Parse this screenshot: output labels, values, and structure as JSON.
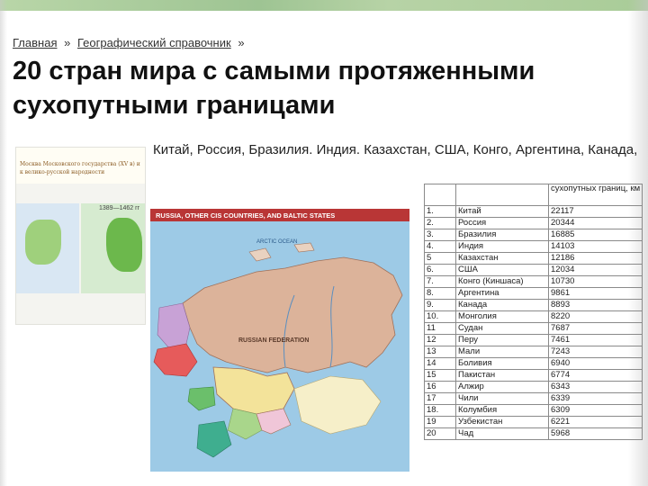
{
  "breadcrumb": {
    "home": "Главная",
    "sep1": "»",
    "section": "Географический справочник",
    "sep2": "»"
  },
  "title": "20 стран мира с самыми протяженными сухопутными границами",
  "countries_line": "Китай, Россия, Бразилия. Индия. Казахстан, США, Конго, Аргентина, Канада,",
  "thumbnail": {
    "caption": "Москва Московского государства (XV в) и к велико-русской народности",
    "inset_label": "1389—1462 гг"
  },
  "map": {
    "header": "RUSSIA, OTHER CIS COUNTRIES, AND BALTIC STATES",
    "label_federation": "RUSSIAN FEDERATION",
    "label_ocean": "ARCTIC OCEAN",
    "colors": {
      "russia": "#dcb39a",
      "kazakhstan": "#f3e39a",
      "ukraine": "#e65b5b",
      "water": "#9dcae6"
    }
  },
  "table": {
    "header_col3": "сухопутных границ, км",
    "rows": [
      {
        "n": "1.",
        "country": "Китай",
        "km": "22117"
      },
      {
        "n": "2.",
        "country": "Россия",
        "km": "20344"
      },
      {
        "n": "3.",
        "country": "Бразилия",
        "km": "16885"
      },
      {
        "n": "4.",
        "country": "Индия",
        "km": "14103"
      },
      {
        "n": "5",
        "country": "Казахстан",
        "km": "12186"
      },
      {
        "n": "6.",
        "country": "США",
        "km": "12034"
      },
      {
        "n": "7.",
        "country": "Конго (Киншаса)",
        "km": "10730"
      },
      {
        "n": "8.",
        "country": "Аргентина",
        "km": "9861"
      },
      {
        "n": "9.",
        "country": "Канада",
        "km": "8893"
      },
      {
        "n": "10.",
        "country": "Монголия",
        "km": "8220"
      },
      {
        "n": "11",
        "country": "Судан",
        "km": "7687"
      },
      {
        "n": "12",
        "country": "Перу",
        "km": "7461"
      },
      {
        "n": "13",
        "country": "Мали",
        "km": "7243"
      },
      {
        "n": "14",
        "country": "Боливия",
        "km": "6940"
      },
      {
        "n": "15",
        "country": "Пакистан",
        "km": "6774"
      },
      {
        "n": "16",
        "country": "Алжир",
        "km": "6343"
      },
      {
        "n": "17",
        "country": "Чили",
        "km": "6339"
      },
      {
        "n": "18.",
        "country": "Колумбия",
        "km": "6309"
      },
      {
        "n": "19",
        "country": "Узбекистан",
        "km": "6221"
      },
      {
        "n": "20",
        "country": "Чад",
        "km": "5968"
      }
    ]
  }
}
